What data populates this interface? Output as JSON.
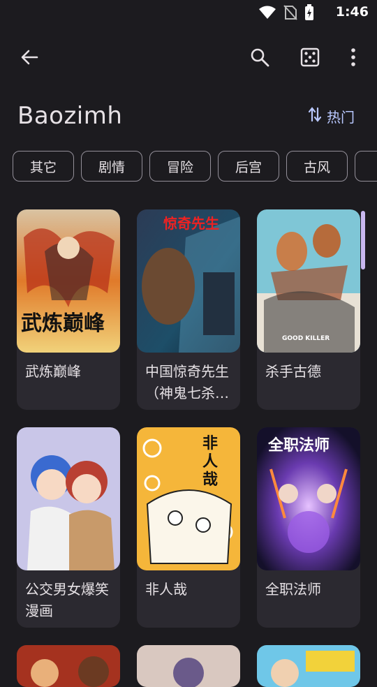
{
  "status": {
    "time": "1:46"
  },
  "appbar": {
    "icons": [
      "back-icon",
      "search-icon",
      "dice-icon",
      "more-icon"
    ]
  },
  "source_title": "Baozimh",
  "sort": {
    "label": "热门",
    "icon": "sort-icon"
  },
  "genres": [
    "其它",
    "剧情",
    "冒险",
    "后宫",
    "古风",
    ""
  ],
  "comics": [
    {
      "title": "武炼巅峰",
      "cover_text": "武炼巅峰"
    },
    {
      "title": "中国惊奇先生（神鬼七杀令）",
      "cover_text": "惊奇先生"
    },
    {
      "title": "杀手古德",
      "cover_text": "GOOD KILLER"
    },
    {
      "title": "公交男女爆笑漫画",
      "cover_text": ""
    },
    {
      "title": "非人哉",
      "cover_text": "非人哉"
    },
    {
      "title": "全职法师",
      "cover_text": "全职法师"
    }
  ],
  "colors": {
    "background": "#1c1b1f",
    "card": "#2b2930",
    "accent": "#b9c8ff",
    "chip_border": "#938f99"
  }
}
